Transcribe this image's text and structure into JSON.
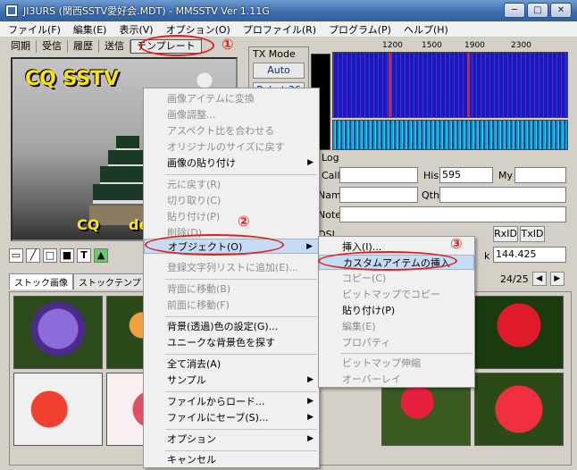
{
  "window": {
    "title": "JI3URS (関西SSTV愛好会.MDT) - MMSSTV Ver 1.11G",
    "min_label": "─",
    "max_label": "□",
    "close_label": "✕"
  },
  "menubar": [
    "ファイル(F)",
    "編集(E)",
    "表示(V)",
    "オプション(O)",
    "プロファイル(R)",
    "プログラム(P)",
    "ヘルプ(H)"
  ],
  "tabs": [
    "同期",
    "受信",
    "履歴",
    "送信",
    "テンプレート"
  ],
  "callouts": [
    "①",
    "②",
    "③"
  ],
  "image_text": {
    "big": "CQ  SSTV",
    "small_left": "CQ",
    "small_right": "de"
  },
  "tx_mode": {
    "label": "TX Mode",
    "buttons": [
      "Auto",
      "Robot 36"
    ]
  },
  "freq_scale": [
    "1200",
    "1500",
    "1900",
    "2300"
  ],
  "log": {
    "title": "Log",
    "call_label": "Call",
    "his_label": "His",
    "his_value": "595",
    "my_label": "My",
    "name_label": "Name",
    "qth_label": "Qth",
    "note_label": "Note",
    "qsl_label": "QSL",
    "rxid_label": "RxID",
    "txid_label": "TxID",
    "freq_value": "144.425",
    "freq_prefix": "k"
  },
  "bottom_tabs": [
    "ストック画像",
    "ストックテンプレート 1"
  ],
  "pager": {
    "text": "24/25",
    "prev": "◀",
    "next": "▶"
  },
  "context_menu": {
    "items": [
      {
        "label": "画像アイテムに変換",
        "disabled": true
      },
      {
        "label": "画像調整...",
        "disabled": true
      },
      {
        "label": "アスペクト比を合わせる",
        "disabled": true
      },
      {
        "label": "オリジナルのサイズに戻す",
        "disabled": true
      },
      {
        "label": "画像の貼り付け",
        "disabled": false,
        "submenu": true
      },
      {
        "label": "元に戻す(R)",
        "disabled": true
      },
      {
        "label": "切り取り(C)",
        "disabled": true
      },
      {
        "label": "貼り付け(P)",
        "disabled": true
      },
      {
        "label": "削除(D)",
        "disabled": true
      },
      {
        "label": "オブジェクト(O)",
        "disabled": false,
        "submenu": true,
        "highlighted": true
      },
      {
        "label": "登録文字列リストに追加(E)...",
        "disabled": true
      },
      {
        "label": "背面に移動(B)",
        "disabled": true
      },
      {
        "label": "前面に移動(F)",
        "disabled": true
      },
      {
        "label": "背景(透過)色の設定(G)...",
        "disabled": false
      },
      {
        "label": "ユニークな背景色を探す",
        "disabled": false
      },
      {
        "label": "全て消去(A)",
        "disabled": false
      },
      {
        "label": "サンプル",
        "disabled": false,
        "submenu": true
      },
      {
        "label": "ファイルからロード...",
        "disabled": false,
        "submenu": true
      },
      {
        "label": "ファイルにセーブ(S)...",
        "disabled": false,
        "submenu": true
      },
      {
        "label": "オプション",
        "disabled": false,
        "submenu": true
      },
      {
        "label": "キャンセル",
        "disabled": false
      }
    ]
  },
  "submenu": {
    "items": [
      {
        "label": "挿入(I)...",
        "disabled": false
      },
      {
        "label": "カスタムアイテムの挿入",
        "disabled": false,
        "highlighted": true
      },
      {
        "label": "コピー(C)",
        "disabled": true
      },
      {
        "label": "ビットマップでコピー",
        "disabled": true
      },
      {
        "label": "貼り付け(P)",
        "disabled": false
      },
      {
        "label": "編集(E)",
        "disabled": true
      },
      {
        "label": "プロパティ",
        "disabled": true
      },
      {
        "label": "ビットマップ伸縮",
        "disabled": true
      },
      {
        "label": "オーバーレイ",
        "disabled": true
      }
    ]
  },
  "colors": {
    "highlight": "#c6dbf5",
    "annotation_red": "#e0201a",
    "spectrum": "#1a1ab8"
  }
}
